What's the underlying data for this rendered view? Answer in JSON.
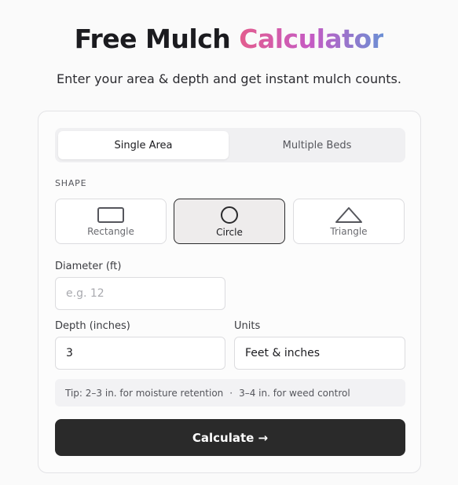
{
  "header": {
    "title_main": "Free Mulch ",
    "title_accent": "Calculator",
    "subtitle": "Enter your area & depth and get instant mulch counts."
  },
  "mode_tabs": [
    {
      "label": "Single Area",
      "active": true
    },
    {
      "label": "Multiple Beds",
      "active": false
    }
  ],
  "shape_section": {
    "label": "SHAPE",
    "options": [
      {
        "label": "Rectangle",
        "icon": "rectangle-icon",
        "selected": false
      },
      {
        "label": "Circle",
        "icon": "circle-icon",
        "selected": true
      },
      {
        "label": "Triangle",
        "icon": "triangle-icon",
        "selected": false
      }
    ]
  },
  "diameter": {
    "label": "Diameter (ft)",
    "placeholder": "e.g. 12",
    "value": ""
  },
  "depth": {
    "label": "Depth (inches)",
    "value": "3"
  },
  "units": {
    "label": "Units",
    "value": "Feet & inches"
  },
  "tip": {
    "part1": "Tip: 2–3 in. for moisture retention",
    "separator": "·",
    "part2": "3–4 in. for weed control"
  },
  "calculate_label": "Calculate →",
  "colors": {
    "accent_gradient_start": "#e35d8e",
    "accent_gradient_mid": "#c55bc4",
    "accent_gradient_end": "#6b8fd4",
    "primary_button": "#2a2a2a"
  }
}
